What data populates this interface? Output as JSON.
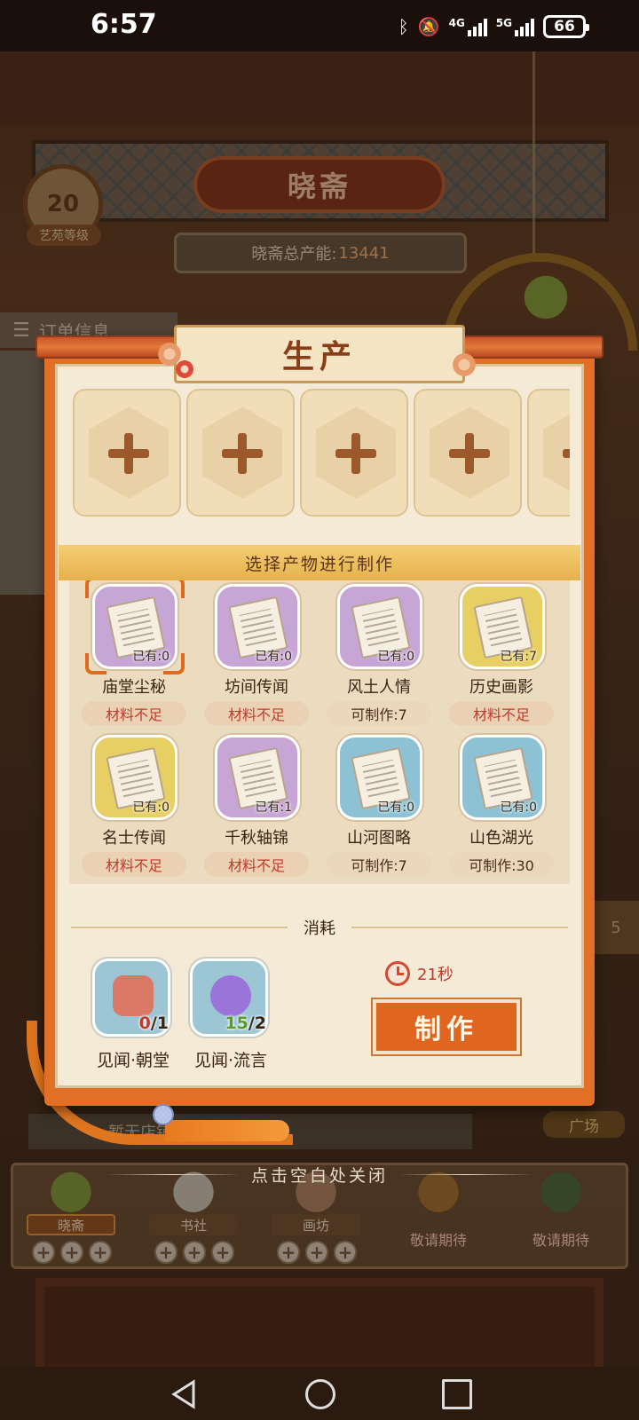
{
  "status_bar": {
    "time": "6:57",
    "battery": "66",
    "net1": "4G",
    "net2": "5G"
  },
  "scene": {
    "title": "晓斋",
    "level": {
      "value": "20",
      "label": "艺苑等级"
    },
    "total_capacity": {
      "label": "晓斋总产能:",
      "value": "13441"
    },
    "order_tab": "订单信息",
    "shop_hint": "暂无店铺",
    "square_label": "广场",
    "right_tag": "5",
    "close_hint": "点击空白处关闭"
  },
  "panel": {
    "title": "生产",
    "select_banner": "选择产物进行制作",
    "slots": [
      {
        "icon": "plus-icon"
      },
      {
        "icon": "plus-icon"
      },
      {
        "icon": "plus-icon"
      },
      {
        "icon": "plus-icon"
      },
      {
        "icon": "plus-icon"
      }
    ],
    "items": [
      {
        "name": "庙堂尘秘",
        "owned": "已有:0",
        "state": "材料不足",
        "color": "purple",
        "ok": false,
        "selected": true
      },
      {
        "name": "坊间传闻",
        "owned": "已有:0",
        "state": "材料不足",
        "color": "purple",
        "ok": false
      },
      {
        "name": "风土人情",
        "owned": "已有:0",
        "state": "可制作:7",
        "color": "purple",
        "ok": true
      },
      {
        "name": "历史画影",
        "owned": "已有:7",
        "state": "材料不足",
        "color": "yellow",
        "ok": false
      },
      {
        "name": "名士传闻",
        "owned": "已有:0",
        "state": "材料不足",
        "color": "yellow",
        "ok": false
      },
      {
        "name": "千秋轴锦",
        "owned": "已有:1",
        "state": "材料不足",
        "color": "purple",
        "ok": false
      },
      {
        "name": "山河图略",
        "owned": "已有:0",
        "state": "可制作:7",
        "color": "blue",
        "ok": true
      },
      {
        "name": "山色湖光",
        "owned": "已有:0",
        "state": "可制作:30",
        "color": "blue",
        "ok": true
      }
    ],
    "consume_title": "消耗",
    "materials": [
      {
        "name": "见闻·朝堂",
        "have": "0",
        "need": "/1",
        "have_color": "#c0392b",
        "icon": "scholar-hat-icon"
      },
      {
        "name": "见闻·流言",
        "have": "15",
        "need": "/2",
        "have_color": "#5a9a2a",
        "icon": "megaphone-icon"
      }
    ],
    "timer": "21秒",
    "make_label": "制作"
  },
  "bottom_stations": [
    {
      "name": "晓斋",
      "active": true,
      "color": "#7da23a"
    },
    {
      "name": "书社",
      "active": false,
      "color": "#d8d4cc"
    },
    {
      "name": "画坊",
      "active": false,
      "color": "#b48a6a"
    },
    {
      "soon": "敬请期待",
      "color": "#a5702a"
    },
    {
      "soon": "敬请期待",
      "color": "#3a6a3a"
    }
  ]
}
